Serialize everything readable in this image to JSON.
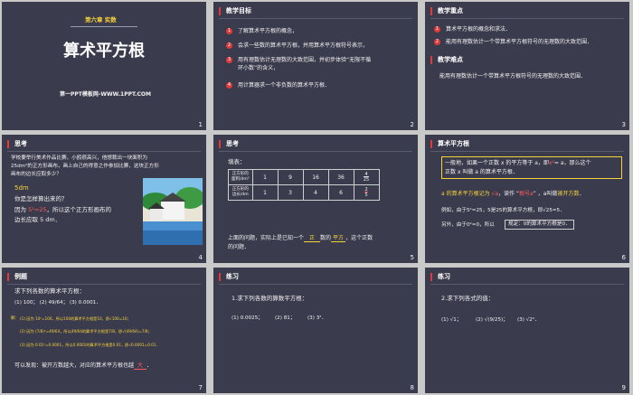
{
  "s1": {
    "chapter": "第六章 实数",
    "title": "算术平方根",
    "footer": "第一PPT模板网-WWW.1PPT.COM",
    "num": "1"
  },
  "s2": {
    "header": "教学目标",
    "items": [
      "了解算术平方根的概念，",
      "会求一些数的算术平方根，并用算术平方根符号表示，",
      "用有理数估计无理数的大致范围，并初步体验“无限不循",
      "环小数”的含义，",
      "用计算器求一个非负数的算术平方根．"
    ],
    "nums": [
      "1",
      "2",
      "3",
      "4"
    ],
    "num": "2"
  },
  "s3": {
    "header1": "教学重点",
    "items": [
      "算术平方根的概念和求法．",
      "能用有理数估计一个带算术平方根符号的无理数的大致范围．"
    ],
    "nums": [
      "1",
      "2"
    ],
    "header2": "教学难点",
    "diff": "能用有理数估计一个带算术平方根符号的无理数的大致范围．",
    "num": "3"
  },
  "s4": {
    "header": "思考",
    "p1": "学校要举行美术作品比赛，小鸥很高兴，他想裁出一块面积为",
    "p2": "25dm²的正方形画布，画上自己的得意之作参加比赛，这块正方形",
    "p3": "画布的边长应取多少？",
    "ans": "5dm",
    "q": "你是怎样算出来的？",
    "r1a": "因为",
    "r1b": "5²=25",
    "r1c": "，所以这个正方形画布的",
    "r2": "边长应取 5 dm．",
    "num": "4"
  },
  "s5": {
    "header": "思考",
    "fill": "填表：",
    "row1head": [
      "正方形的",
      "面积/dm²"
    ],
    "row1": [
      "1",
      "9",
      "16",
      "36"
    ],
    "frac1": [
      "4",
      "25"
    ],
    "row2head": [
      "正方形的",
      "边长/dm"
    ],
    "row2": [
      "1",
      "3",
      "4",
      "6"
    ],
    "frac2": [
      "2",
      "5"
    ],
    "p1a": "上面的问题，实际上是已知一个",
    "p1b": "正",
    "p1c": "数的",
    "p1d": "平方",
    "p1e": "，这个正数",
    "p2": "的问题．",
    "num": "5"
  },
  "s6": {
    "header": "算术平方根",
    "d1a": "一般地，如果一个正数 x 的平方等于 a，即",
    "d1b": "x²",
    "d1c": "= a，那么这个",
    "d2": "正数 x 叫做 a 的算术平方根．",
    "l1a": "a 的算术平方根记为",
    "l1b": "√a",
    "l1c": "，读作 “",
    "l1d": "根号a",
    "l1e": "” ，a叫做",
    "l1f": "被开方数",
    "l1g": "．",
    "ex": "例如，由于5²=25，5是25的算术平方根，即√25=5．",
    "ex2": "另外，由于0²=0，所以",
    "rule": "规定：0的算术平方根是0．",
    "num": "6"
  },
  "s7": {
    "header": "例题",
    "q": "求下列各数的算术平方根：",
    "items": "(1) 100；  (2) 49/64；  (3) 0.0001．",
    "solve": "解：",
    "a1": "(1) 因为 10²=100，所以100的算术平方根是10，即√100=10；",
    "a2": "(2) 因为 (7/8)²=49/64，所以49/64的算术平方根是7/8，即√(49/64)=7/8；",
    "a3": "(3) 因为 0.01²=0.0001，所以0.0001的算术平方根是0.01，即√0.0001=0.01．",
    "c1": "可以发现：被开方数越大，对应的算术平方根也越",
    "c2": "大",
    "c3": "．",
    "num": "7"
  },
  "s8": {
    "header": "练习",
    "q": "1.求下列各数的算数平方根：",
    "items": [
      "(1) 0.0025；",
      "(2) 81；",
      "(3) 3²．"
    ],
    "num": "8"
  },
  "s9": {
    "header": "练习",
    "q": "2.求下列各式的值：",
    "items": [
      "(1) √1；",
      "(2) √(9/25)；",
      "(3) √2²．"
    ],
    "num": "9"
  }
}
